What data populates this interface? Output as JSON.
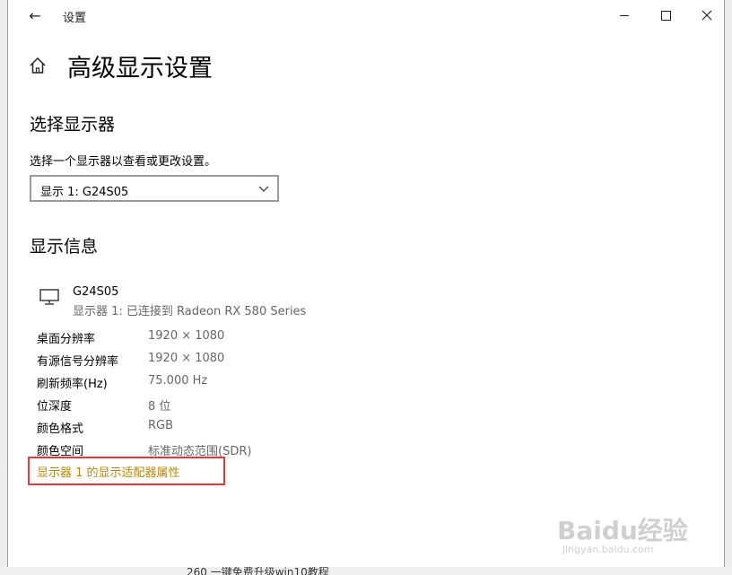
{
  "window": {
    "title": "设置",
    "back_icon": "←"
  },
  "header": {
    "page_title": "高级显示设置"
  },
  "select_display": {
    "heading": "选择显示器",
    "description": "选择一个显示器以查看或更改设置。",
    "dropdown_value": "显示 1: G24S05"
  },
  "display_info": {
    "heading": "显示信息",
    "monitor_name": "G24S05",
    "monitor_connection": "显示器 1: 已连接到 Radeon RX 580 Series",
    "rows": [
      {
        "label": "桌面分辨率",
        "value": "1920 × 1080"
      },
      {
        "label": "有源信号分辨率",
        "value": "1920 × 1080"
      },
      {
        "label": "刷新频率(Hz)",
        "value": "75.000 Hz"
      },
      {
        "label": "位深度",
        "value": "8 位"
      },
      {
        "label": "颜色格式",
        "value": "RGB"
      },
      {
        "label": "颜色空间",
        "value": "标准动态范围(SDR)"
      }
    ],
    "adapter_link": "显示器 1 的显示适配器属性"
  },
  "background": {
    "taskbar_text": "260 一键免费升级win10教程"
  },
  "watermark": {
    "main": "Baidu经验",
    "sub": "jingyan.baidu.com"
  },
  "colors": {
    "link": "#b8860b",
    "highlight": "#e23a3a",
    "secondary_text": "#666666"
  }
}
